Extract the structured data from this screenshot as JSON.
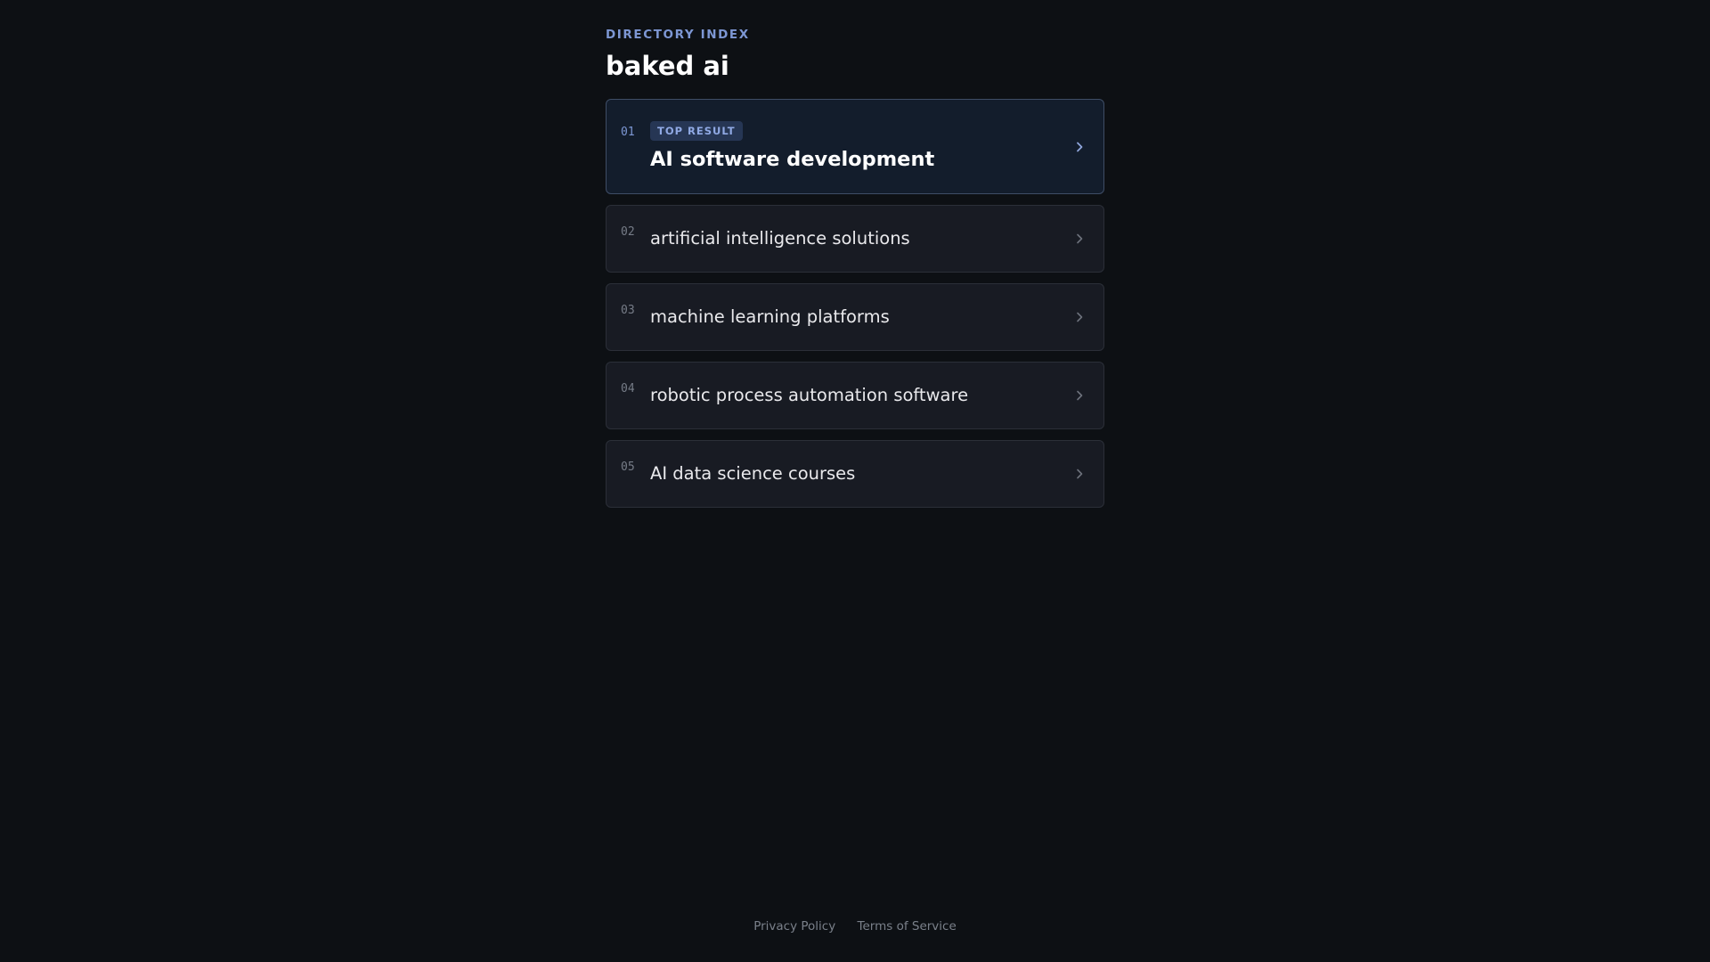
{
  "header": {
    "eyebrow": "DIRECTORY INDEX",
    "title": "baked ai"
  },
  "results": [
    {
      "number": "01",
      "badge": "TOP RESULT",
      "label": "AI software development"
    },
    {
      "number": "02",
      "label": "artificial intelligence solutions"
    },
    {
      "number": "03",
      "label": "machine learning platforms"
    },
    {
      "number": "04",
      "label": "robotic process automation software"
    },
    {
      "number": "05",
      "label": "AI data science courses"
    }
  ],
  "footer": {
    "privacy": "Privacy Policy",
    "terms": "Terms of Service"
  },
  "icons": {
    "chevron": "chevron-right-icon"
  },
  "colors": {
    "background": "#0d1014",
    "accent": "#7d97d4",
    "card": "#181b23",
    "card_top": "#131d2c"
  }
}
